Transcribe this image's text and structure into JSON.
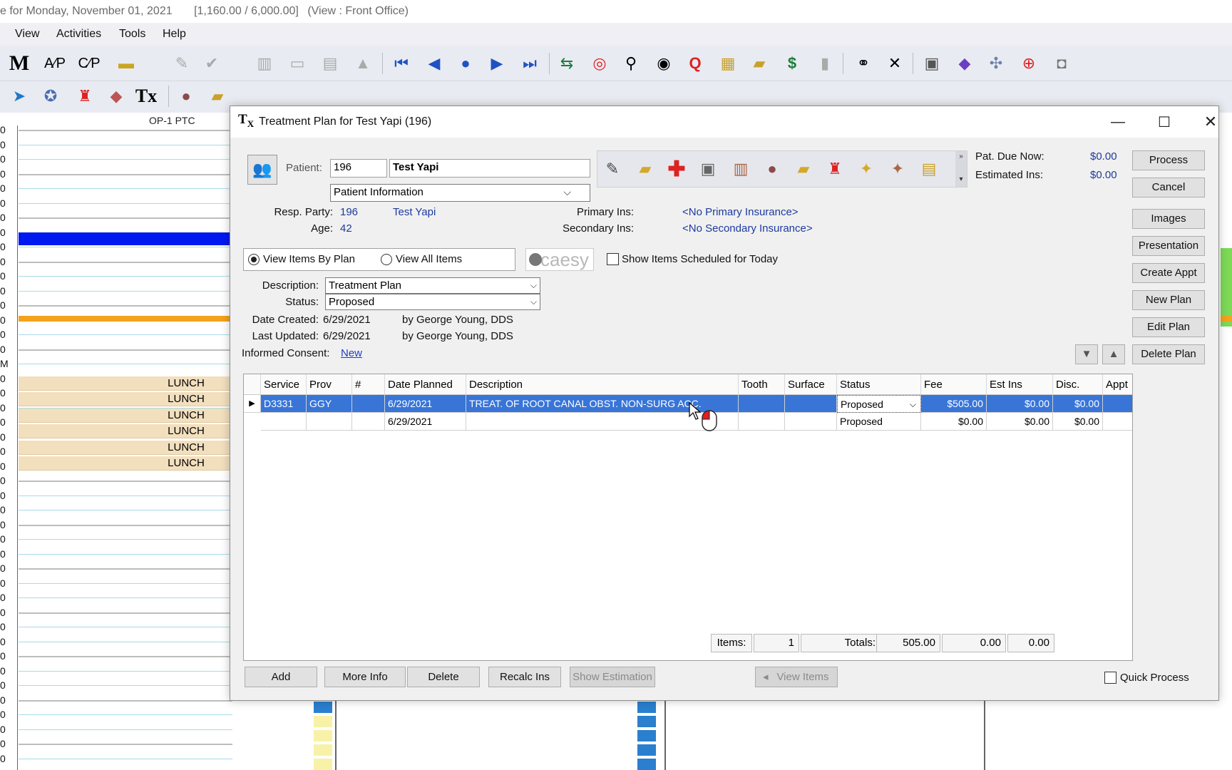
{
  "app": {
    "title": "e for Monday, November 01, 2021",
    "balance": "[1,160.00 / 6,000.00]",
    "view": "(View : Front Office)"
  },
  "menu": [
    "View",
    "Activities",
    "Tools",
    "Help"
  ],
  "schedule": {
    "column_header": "OP-1 PTC",
    "lunch_label": "LUNCH",
    "time_digit": "0",
    "m_tick": "M"
  },
  "dialog": {
    "title": "Treatment Plan for Test Yapi (196)",
    "patient_label": "Patient:",
    "patient_id": "196",
    "patient_name": "Test Yapi",
    "info_select": "Patient Information",
    "resp_party_label": "Resp. Party:",
    "resp_party_id": "196",
    "resp_party_name": "Test Yapi",
    "age_label": "Age:",
    "age": "42",
    "primary_ins_label": "Primary Ins:",
    "primary_ins": "<No Primary Insurance>",
    "secondary_ins_label": "Secondary Ins:",
    "secondary_ins": "<No Secondary Insurance>",
    "pat_due_label": "Pat. Due Now:",
    "pat_due": "$0.00",
    "est_ins_label": "Estimated Ins:",
    "est_ins": "$0.00",
    "view_by_plan": "View Items By Plan",
    "view_all": "View All Items",
    "caesy": "caesy",
    "show_scheduled": "Show Items Scheduled for Today",
    "description_label": "Description:",
    "description": "Treatment Plan",
    "status_label": "Status:",
    "status": "Proposed",
    "date_created_label": "Date Created:",
    "date_created": "6/29/2021",
    "created_by": "by  George Young, DDS",
    "last_updated_label": "Last Updated:",
    "last_updated": "6/29/2021",
    "updated_by": "by  George Young, DDS",
    "consent_label": "Informed Consent:",
    "consent_link": "New",
    "side_buttons": [
      "Process",
      "Cancel",
      "Images",
      "Presentation",
      "Create Appt",
      "New Plan",
      "Edit Plan",
      "Delete Plan"
    ],
    "grid": {
      "columns": [
        "Service",
        "Prov",
        "#",
        "Date Planned",
        "Description",
        "Tooth",
        "Surface",
        "Status",
        "Fee",
        "Est Ins",
        "Disc.",
        "Appt"
      ],
      "rows": [
        [
          "D3331",
          "GGY",
          "",
          "6/29/2021",
          "TREAT. OF ROOT CANAL OBST. NON-SURG ACC.",
          "",
          "",
          "Proposed",
          "$505.00",
          "$0.00",
          "$0.00",
          ""
        ],
        [
          "",
          "",
          "",
          "6/29/2021",
          "",
          "",
          "",
          "Proposed",
          "$0.00",
          "$0.00",
          "$0.00",
          ""
        ]
      ],
      "items_label": "Items:",
      "items_count": "1",
      "totals_label": "Totals:",
      "total_fee": "505.00",
      "total_ins": "0.00",
      "total_disc": "0.00"
    },
    "bottom_buttons": [
      "Add",
      "More Info",
      "Delete",
      "Recalc Ins",
      "Show Estimation",
      "View Items"
    ],
    "quick_process": "Quick Process"
  },
  "colors": {
    "selection": "#3875d7",
    "link": "#1a3fc9",
    "value_blue": "#1d3a9e",
    "lunch": "#f2dfbe",
    "appt_blue": "#0018f0",
    "orange_band": "#f4a21c"
  }
}
